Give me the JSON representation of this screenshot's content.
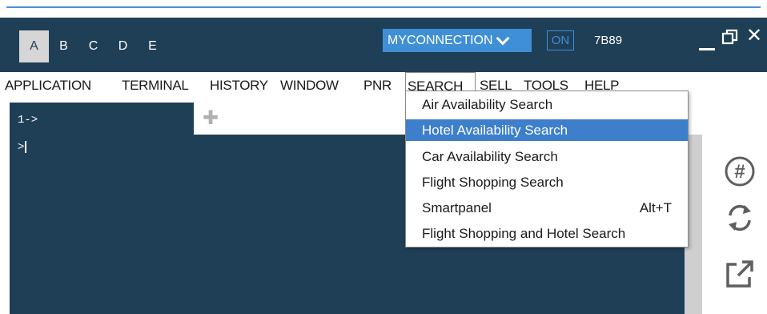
{
  "workspace_tabs": [
    "A",
    "B",
    "C",
    "D",
    "E"
  ],
  "active_workspace": "A",
  "connection": {
    "label": "MYCONNECTION",
    "status": "ON",
    "pcc": "7B89"
  },
  "menu": [
    "APPLICATION",
    "TERMINAL",
    "HISTORY",
    "WINDOW",
    "PNR",
    "SEARCH",
    "SELL",
    "TOOLS",
    "HELP"
  ],
  "open_menu": "SEARCH",
  "search_menu": [
    {
      "label": "Air Availability Search",
      "shortcut": ""
    },
    {
      "label": "Hotel Availability Search",
      "shortcut": "",
      "highlighted": true
    },
    {
      "label": "Car Availability Search",
      "shortcut": ""
    },
    {
      "label": "Flight Shopping Search",
      "shortcut": ""
    },
    {
      "label": "Smartpanel",
      "shortcut": "Alt+T"
    },
    {
      "label": "Flight Shopping and Hotel Search",
      "shortcut": ""
    }
  ],
  "terminal": {
    "tab_label": "1->",
    "prompt": ">"
  },
  "colors": {
    "titlebar": "#1f3f57",
    "accent": "#3f8fd6",
    "highlight": "#3d7fca"
  },
  "icons": [
    "minimize-icon",
    "restore-icon",
    "close-icon",
    "add-tab-icon",
    "hash-icon",
    "refresh-icon",
    "popout-icon"
  ]
}
